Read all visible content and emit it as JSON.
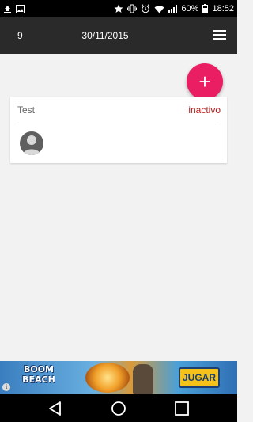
{
  "status_bar": {
    "battery": "60%",
    "time": "18:52"
  },
  "app_bar": {
    "count": "9",
    "date": "30/11/2015"
  },
  "fab": {
    "label": "+"
  },
  "card": {
    "title": "Test",
    "status": "inactivo"
  },
  "ad": {
    "logo": "BOOM BEACH",
    "cta": "JUGAR",
    "info": "i"
  },
  "colors": {
    "accent": "#e91e63",
    "app_bar": "#2a2a2a",
    "status_inactive": "#b71c1c",
    "background": "#f2f2f2"
  }
}
